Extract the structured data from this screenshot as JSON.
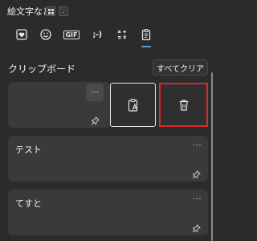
{
  "window": {
    "title": "絵文字など",
    "shortcut_key_symbol": "."
  },
  "tabs": [
    {
      "icon": "heart-sticker-icon"
    },
    {
      "icon": "smiley-icon"
    },
    {
      "icon": "gif-icon",
      "label": "GIF"
    },
    {
      "icon": "kaomoji-icon",
      "label": ";-)"
    },
    {
      "icon": "symbols-icon"
    },
    {
      "icon": "clipboard-icon",
      "selected": true
    }
  ],
  "clipboard": {
    "title": "クリップボード",
    "clear_all_label": "すべてクリア",
    "more_label": "···",
    "items": [
      {
        "text": "",
        "actions": [
          "paste-as-text-icon",
          "delete-icon"
        ]
      },
      {
        "text": "テスト"
      },
      {
        "text": "てすと"
      }
    ]
  },
  "colors": {
    "background": "#2b2b2b",
    "card": "#3a3a3a",
    "accent": "#5aa0e6",
    "highlight": "#d62b2b"
  }
}
